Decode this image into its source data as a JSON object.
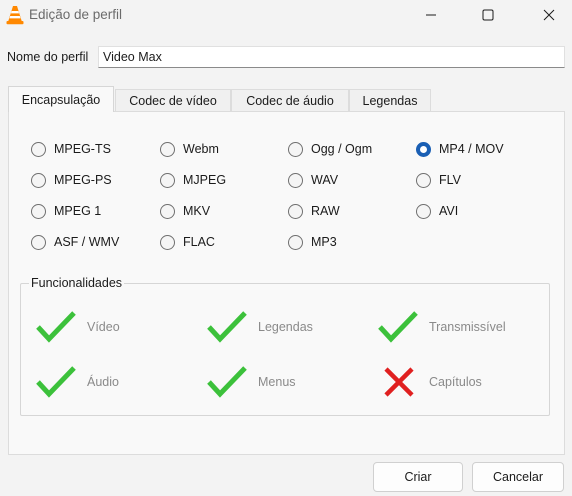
{
  "window": {
    "title": "Edição de perfil",
    "app_icon": "vlc-cone-icon",
    "controls": [
      "minimize-icon",
      "maximize-icon",
      "close-icon"
    ]
  },
  "profile": {
    "name_label": "Nome do perfil",
    "name_value": "Video Max"
  },
  "tabs": [
    {
      "label": "Encapsulação",
      "active": true
    },
    {
      "label": "Codec de vídeo",
      "active": false
    },
    {
      "label": "Codec de áudio",
      "active": false
    },
    {
      "label": "Legendas",
      "active": false
    }
  ],
  "encapsulation": {
    "selected": "MP4 / MOV",
    "options": [
      "MPEG-TS",
      "Webm",
      "Ogg / Ogm",
      "MP4 / MOV",
      "MPEG-PS",
      "MJPEG",
      "WAV",
      "FLV",
      "MPEG 1",
      "MKV",
      "RAW",
      "AVI",
      "ASF / WMV",
      "FLAC",
      "MP3"
    ]
  },
  "features": {
    "title": "Funcionalidades",
    "items": [
      {
        "label": "Vídeo",
        "supported": true
      },
      {
        "label": "Legendas",
        "supported": true
      },
      {
        "label": "Transmissível",
        "supported": true
      },
      {
        "label": "Áudio",
        "supported": true
      },
      {
        "label": "Menus",
        "supported": true
      },
      {
        "label": "Capítulos",
        "supported": false
      }
    ]
  },
  "buttons": {
    "ok": "Criar",
    "cancel": "Cancelar"
  },
  "colors": {
    "accent": "#1a5fb4",
    "check_green": "#3cc13b",
    "cross_red": "#e02020"
  }
}
